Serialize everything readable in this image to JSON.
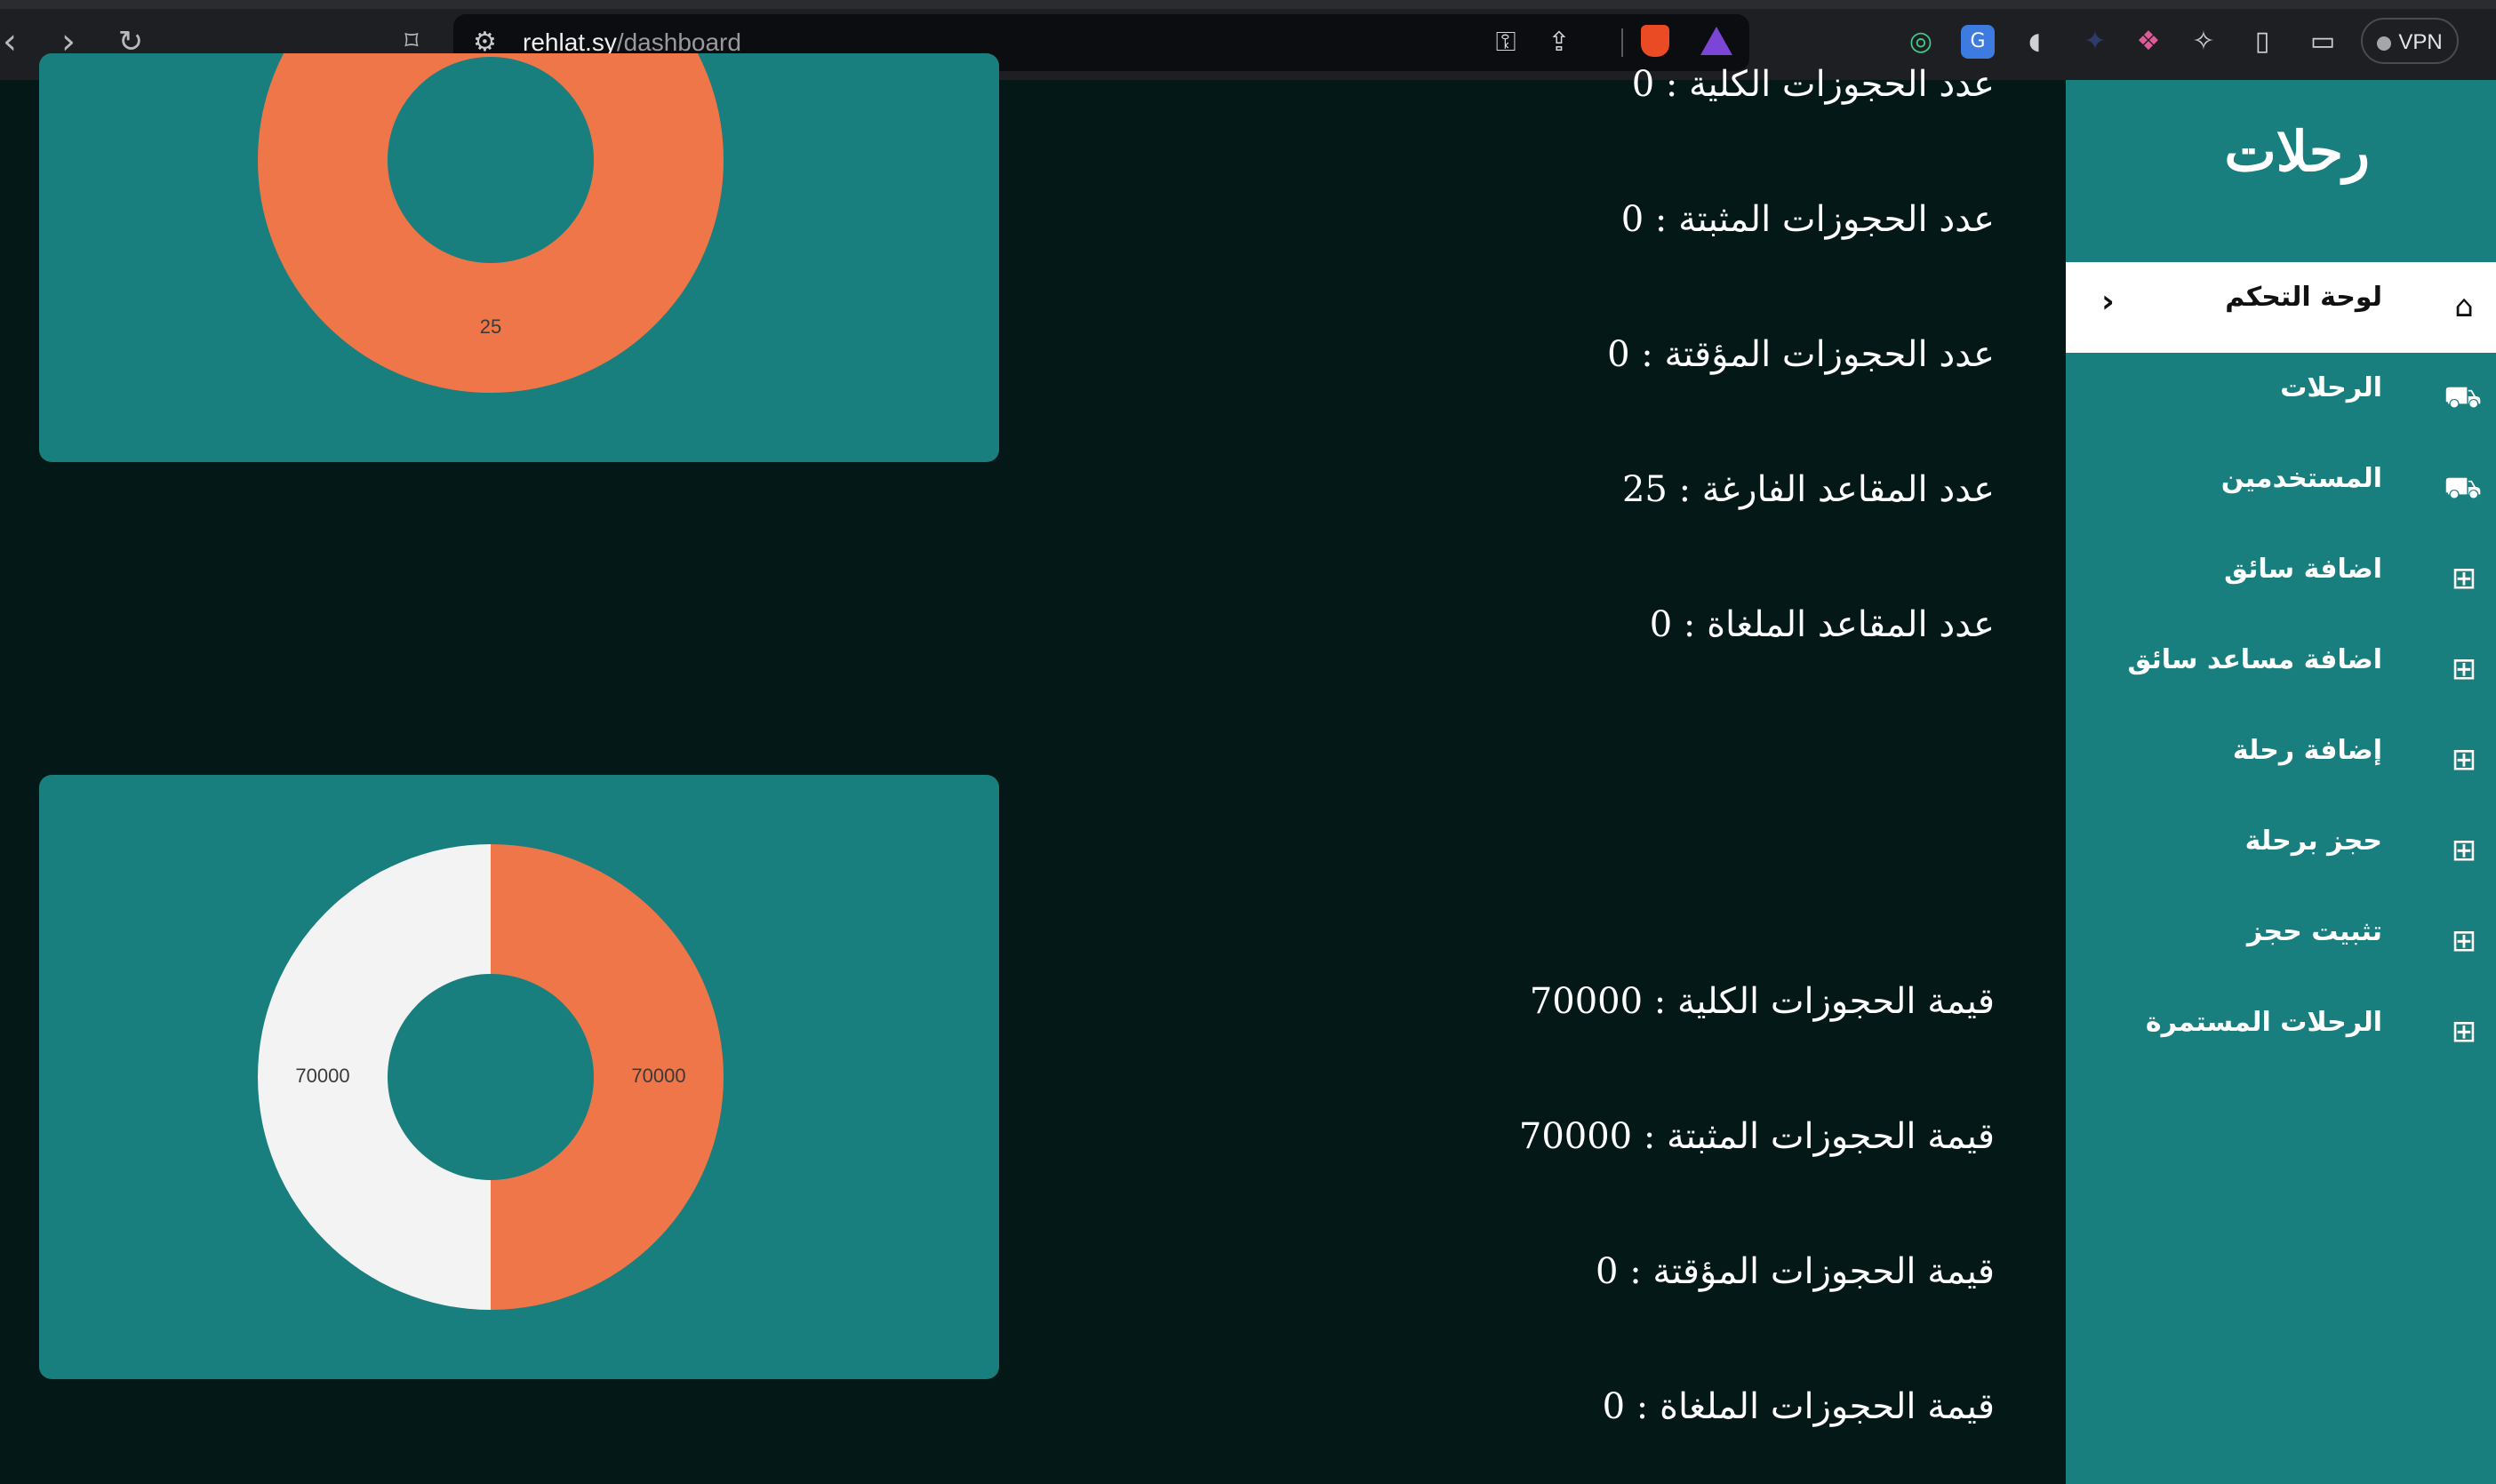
{
  "browser": {
    "url_host": "rehlat.sy",
    "url_path": "/dashboard",
    "vpn_label": "VPN"
  },
  "sidebar": {
    "brand": "رحلات",
    "items": [
      {
        "label": "لوحة التحكم",
        "icon": "home-icon",
        "active": true
      },
      {
        "label": "الرحلات",
        "icon": "bus-icon"
      },
      {
        "label": "المستخدمين",
        "icon": "bus-icon"
      },
      {
        "label": "اضافة سائق",
        "icon": "add-box-icon"
      },
      {
        "label": "اضافة مساعد سائق",
        "icon": "add-box-icon"
      },
      {
        "label": "إضافة رحلة",
        "icon": "add-box-icon"
      },
      {
        "label": "حجز برحلة",
        "icon": "add-box-icon"
      },
      {
        "label": "تثبيت حجز",
        "icon": "add-box-icon"
      },
      {
        "label": "الرحلات المستمرة",
        "icon": "add-box-icon"
      }
    ]
  },
  "stats": {
    "bookings": [
      "عدد الحجوزات الكلية : 0",
      "عدد الحجوزات المثبتة : 0",
      "عدد الحجوزات المؤقتة : 0",
      "عدد المقاعد الفارغة : 25",
      "عدد المقاعد الملغاة : 0"
    ],
    "values": [
      "قيمة الحجوزات الكلية : 70000",
      "قيمة الحجوزات المثبتة : 70000",
      "قيمة الحجوزات المؤقتة : 0",
      "قيمة الحجوزات الملغاة : 0"
    ]
  },
  "chart_data": [
    {
      "type": "pie",
      "donut": true,
      "values": [
        25
      ],
      "labels": [
        "25"
      ],
      "colors": [
        "#ee7648"
      ]
    },
    {
      "type": "pie",
      "donut": true,
      "values": [
        70000,
        70000
      ],
      "labels": [
        "70000",
        "70000"
      ],
      "colors": [
        "#ee7648",
        "#f3f3f3"
      ]
    }
  ]
}
